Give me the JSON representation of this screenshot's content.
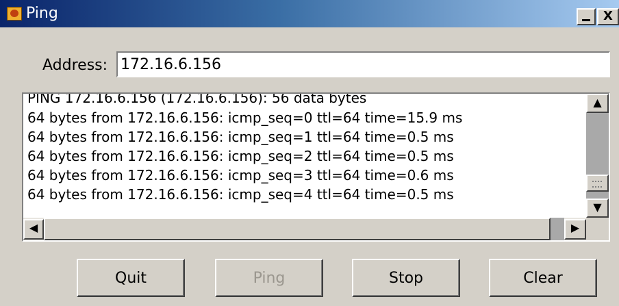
{
  "window": {
    "title": "Ping",
    "minimize_glyph": "",
    "close_glyph": "X"
  },
  "address": {
    "label": "Address:",
    "value": "172.16.6.156"
  },
  "output": {
    "lines": [
      "PING 172.16.6.156 (172.16.6.156): 56 data bytes",
      "64 bytes from 172.16.6.156: icmp_seq=0 ttl=64 time=15.9 ms",
      "64 bytes from 172.16.6.156: icmp_seq=1 ttl=64 time=0.5 ms",
      "64 bytes from 172.16.6.156: icmp_seq=2 ttl=64 time=0.5 ms",
      "64 bytes from 172.16.6.156: icmp_seq=3 ttl=64 time=0.6 ms",
      "64 bytes from 172.16.6.156: icmp_seq=4 ttl=64 time=0.5 ms"
    ]
  },
  "scrollbars": {
    "up_glyph": "▲",
    "down_glyph": "▼",
    "left_glyph": "◀",
    "right_glyph": "▶"
  },
  "buttons": {
    "quit": "Quit",
    "ping": "Ping",
    "stop": "Stop",
    "clear": "Clear"
  },
  "icons": {
    "app": "java-cup-icon",
    "minimize": "minimize-icon",
    "close": "close-icon"
  }
}
